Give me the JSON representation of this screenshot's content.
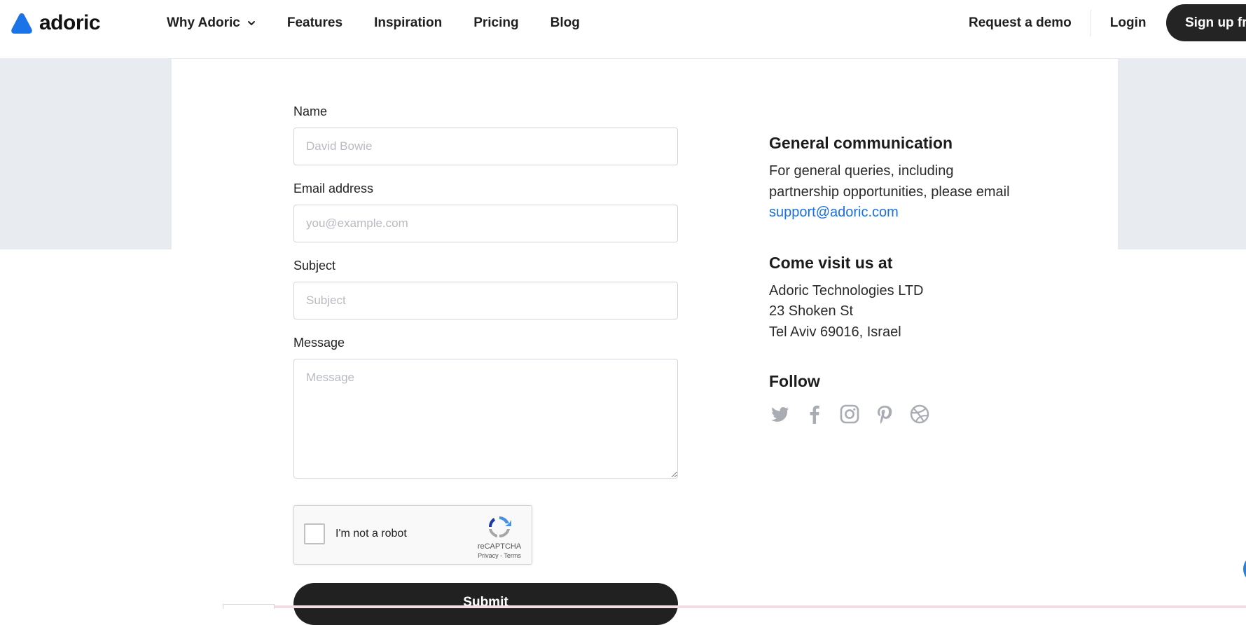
{
  "brand": {
    "name": "adoric",
    "color": "#1a73e8"
  },
  "nav": {
    "items": [
      {
        "label": "Why Adoric",
        "has_dropdown": true
      },
      {
        "label": "Features"
      },
      {
        "label": "Inspiration"
      },
      {
        "label": "Pricing"
      },
      {
        "label": "Blog"
      }
    ],
    "request_demo": "Request a demo",
    "login": "Login",
    "signup": "Sign up fre"
  },
  "form": {
    "name": {
      "label": "Name",
      "placeholder": "David Bowie"
    },
    "email": {
      "label": "Email address",
      "placeholder": "you@example.com"
    },
    "subject": {
      "label": "Subject",
      "placeholder": "Subject"
    },
    "message": {
      "label": "Message",
      "placeholder": "Message"
    },
    "captcha": {
      "label": "I'm not a robot",
      "brand": "reCAPTCHA",
      "links": "Privacy - Terms"
    },
    "submit": "Submit"
  },
  "contact": {
    "general": {
      "heading": "General communication",
      "text": "For general queries, including partnership opportunities, please email ",
      "email": "support@adoric.com"
    },
    "visit": {
      "heading": "Come visit us at",
      "lines": [
        "Adoric Technologies LTD",
        "23 Shoken St",
        "Tel Aviv 69016, Israel"
      ]
    },
    "follow": {
      "heading": "Follow",
      "icons": [
        "twitter-icon",
        "facebook-icon",
        "instagram-icon",
        "pinterest-icon",
        "dribbble-icon"
      ],
      "icon_color": "#a9adb3"
    }
  }
}
